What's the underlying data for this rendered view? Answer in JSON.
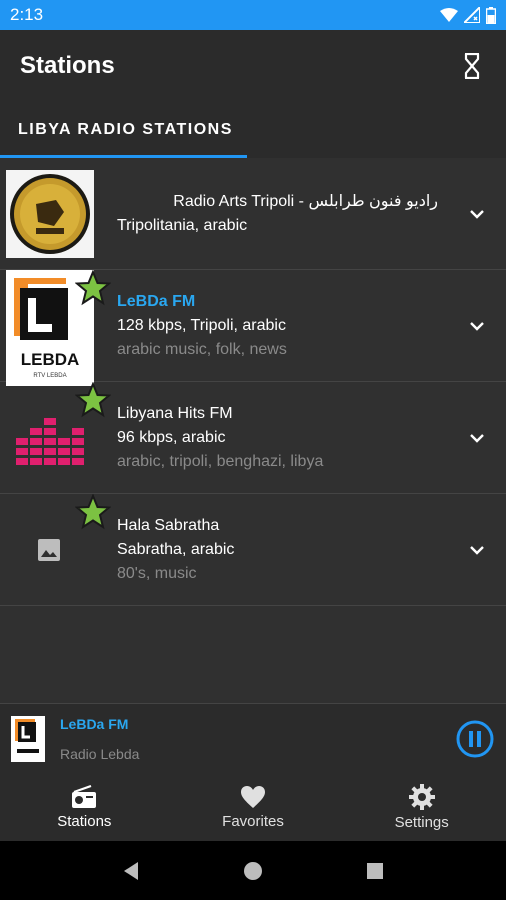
{
  "status_bar": {
    "time": "2:13"
  },
  "toolbar": {
    "title": "Stations",
    "timer_icon": "hourglass-icon"
  },
  "tabs": [
    {
      "label": "LIBYA RADIO STATIONS"
    }
  ],
  "stations": [
    {
      "name": "Radio Arts Tripoli - راديو فنون طرابلس",
      "info": "Tripolitania, arabic",
      "tags": "",
      "favorite": false,
      "active": false
    },
    {
      "name": "LeBDa FM",
      "info": "128 kbps, Tripoli, arabic",
      "tags": "arabic music, folk, news",
      "favorite": true,
      "active": true
    },
    {
      "name": "Libyana Hits FM",
      "info": "96 kbps, arabic",
      "tags": "arabic, tripoli, benghazi, libya",
      "favorite": true,
      "active": false
    },
    {
      "name": "Hala Sabratha",
      "info": "Sabratha, arabic",
      "tags": "80's, music",
      "favorite": true,
      "active": false
    }
  ],
  "now_playing": {
    "title": "LeBDa FM",
    "subtitle": "Radio Lebda"
  },
  "bottom_nav": [
    {
      "label": "Stations",
      "icon": "radio-icon"
    },
    {
      "label": "Favorites",
      "icon": "heart-icon"
    },
    {
      "label": "Settings",
      "icon": "gear-icon"
    }
  ],
  "colors": {
    "accent": "#2196f3",
    "active_text": "#2aa7f0",
    "star_fill": "#7cc242",
    "background": "#303030"
  }
}
